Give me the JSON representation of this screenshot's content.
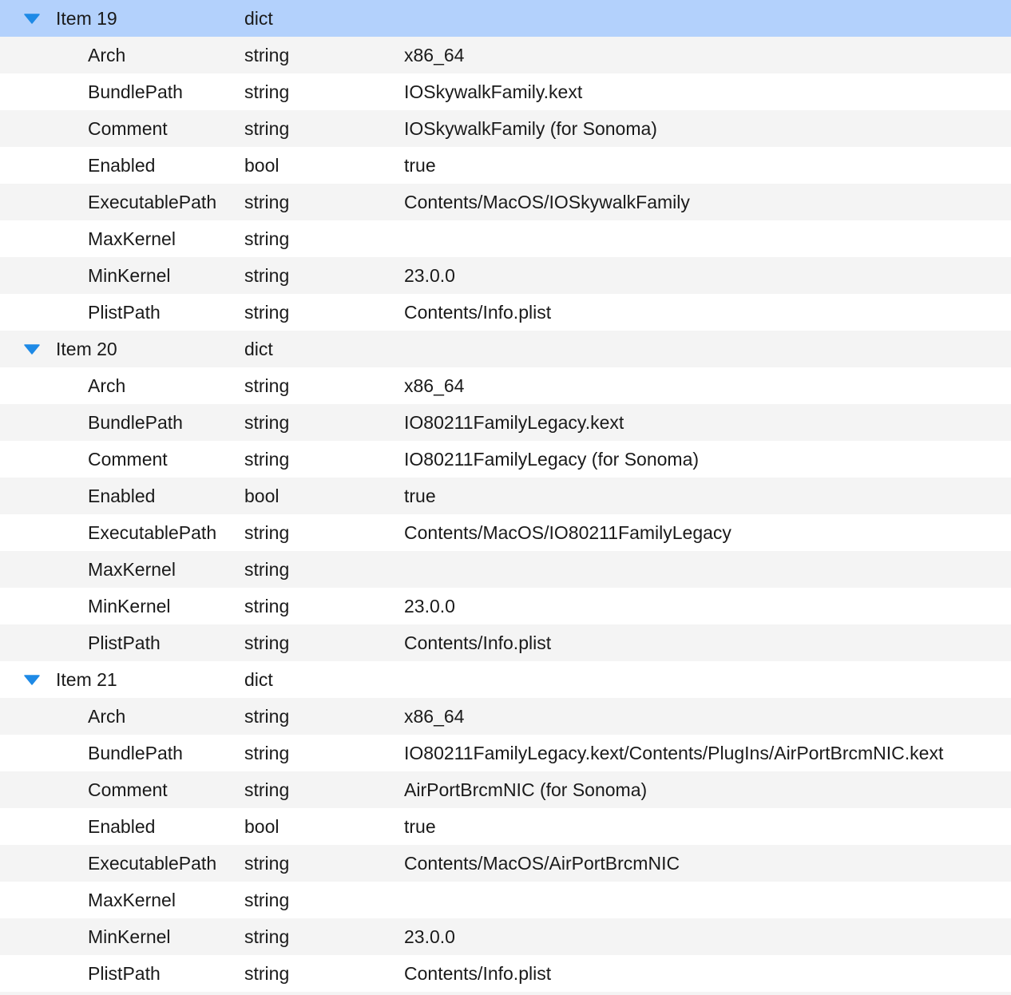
{
  "colors": {
    "selected_row": "#b3d1fc",
    "stripe_row": "#f4f4f4",
    "plain_row": "#ffffff",
    "disclosure_triangle": "#1e8ae6",
    "text": "#1a1a1a"
  },
  "disclosure_icon": "triangle-down-icon",
  "items": [
    {
      "key": "Item 19",
      "type": "dict",
      "expanded": true,
      "selected": true,
      "children": [
        {
          "key": "Arch",
          "type": "string",
          "value": "x86_64"
        },
        {
          "key": "BundlePath",
          "type": "string",
          "value": "IOSkywalkFamily.kext"
        },
        {
          "key": "Comment",
          "type": "string",
          "value": "IOSkywalkFamily (for Sonoma)"
        },
        {
          "key": "Enabled",
          "type": "bool",
          "value": "true"
        },
        {
          "key": "ExecutablePath",
          "type": "string",
          "value": "Contents/MacOS/IOSkywalkFamily"
        },
        {
          "key": "MaxKernel",
          "type": "string",
          "value": ""
        },
        {
          "key": "MinKernel",
          "type": "string",
          "value": "23.0.0"
        },
        {
          "key": "PlistPath",
          "type": "string",
          "value": "Contents/Info.plist"
        }
      ]
    },
    {
      "key": "Item 20",
      "type": "dict",
      "expanded": true,
      "selected": false,
      "children": [
        {
          "key": "Arch",
          "type": "string",
          "value": "x86_64"
        },
        {
          "key": "BundlePath",
          "type": "string",
          "value": "IO80211FamilyLegacy.kext"
        },
        {
          "key": "Comment",
          "type": "string",
          "value": "IO80211FamilyLegacy (for Sonoma)"
        },
        {
          "key": "Enabled",
          "type": "bool",
          "value": "true"
        },
        {
          "key": "ExecutablePath",
          "type": "string",
          "value": "Contents/MacOS/IO80211FamilyLegacy"
        },
        {
          "key": "MaxKernel",
          "type": "string",
          "value": ""
        },
        {
          "key": "MinKernel",
          "type": "string",
          "value": "23.0.0"
        },
        {
          "key": "PlistPath",
          "type": "string",
          "value": "Contents/Info.plist"
        }
      ]
    },
    {
      "key": "Item 21",
      "type": "dict",
      "expanded": true,
      "selected": false,
      "children": [
        {
          "key": "Arch",
          "type": "string",
          "value": "x86_64"
        },
        {
          "key": "BundlePath",
          "type": "string",
          "value": "IO80211FamilyLegacy.kext/Contents/PlugIns/AirPortBrcmNIC.kext"
        },
        {
          "key": "Comment",
          "type": "string",
          "value": "AirPortBrcmNIC (for Sonoma)"
        },
        {
          "key": "Enabled",
          "type": "bool",
          "value": "true"
        },
        {
          "key": "ExecutablePath",
          "type": "string",
          "value": "Contents/MacOS/AirPortBrcmNIC"
        },
        {
          "key": "MaxKernel",
          "type": "string",
          "value": ""
        },
        {
          "key": "MinKernel",
          "type": "string",
          "value": "23.0.0"
        },
        {
          "key": "PlistPath",
          "type": "string",
          "value": "Contents/Info.plist"
        }
      ]
    }
  ]
}
